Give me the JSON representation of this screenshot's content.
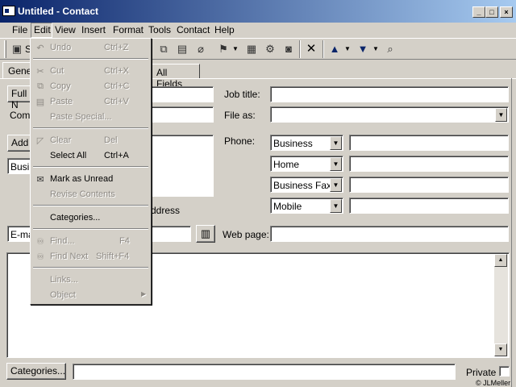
{
  "window": {
    "title": "Untitled - Contact",
    "min_glyph": "_",
    "max_glyph": "□",
    "close_glyph": "×"
  },
  "menubar": {
    "items": [
      "File",
      "Edit",
      "View",
      "Insert",
      "Format",
      "Tools",
      "Contact",
      "Help"
    ]
  },
  "toolbar": {
    "save_label_partial": "S",
    "icons": [
      "save-icon",
      "copy-icon",
      "paste-icon",
      "attach-icon",
      "follow-up-icon",
      "new-item-icon",
      "properties-icon",
      "address-book-icon",
      "delete-icon",
      "previous-item-icon",
      "next-item-icon",
      "find-contact-icon"
    ]
  },
  "tabs": {
    "general_partial": "Gene",
    "all_fields": "All Fields"
  },
  "form": {
    "full_name_partial": "Full N",
    "company_partial": "Comp",
    "job_title_label": "Job title:",
    "file_as_label": "File as:",
    "address_button_partial": "Add",
    "address_type_partial": "Busin",
    "mailing_address_partial": "ddress",
    "phone_label": "Phone:",
    "phones": [
      {
        "type": "Business",
        "value": ""
      },
      {
        "type": "Home",
        "value": ""
      },
      {
        "type": "Business Fax",
        "value": ""
      },
      {
        "type": "Mobile",
        "value": ""
      }
    ],
    "email_partial": "E-mai",
    "web_page_label": "Web page:",
    "categories_button": "Categories...",
    "private_label": "Private",
    "copyright": "© JLMeller"
  },
  "edit_menu": {
    "items": [
      {
        "label": "Undo",
        "shortcut": "Ctrl+Z",
        "disabled": true,
        "icon": "undo-icon"
      },
      {
        "label": "Cut",
        "shortcut": "Ctrl+X",
        "disabled": true,
        "icon": "cut-icon"
      },
      {
        "label": "Copy",
        "shortcut": "Ctrl+C",
        "disabled": true,
        "icon": "copy-icon"
      },
      {
        "label": "Paste",
        "shortcut": "Ctrl+V",
        "disabled": true,
        "icon": "paste-icon"
      },
      {
        "label": "Paste Special...",
        "shortcut": "",
        "disabled": true,
        "icon": ""
      },
      {
        "label": "Clear",
        "shortcut": "Del",
        "disabled": true,
        "icon": "eraser-icon"
      },
      {
        "label": "Select All",
        "shortcut": "Ctrl+A",
        "disabled": false,
        "icon": ""
      },
      {
        "label": "Mark as Unread",
        "shortcut": "",
        "disabled": false,
        "icon": "envelope-icon"
      },
      {
        "label": "Revise Contents",
        "shortcut": "",
        "disabled": true,
        "icon": ""
      },
      {
        "label": "Categories...",
        "shortcut": "",
        "disabled": false,
        "icon": ""
      },
      {
        "label": "Find...",
        "shortcut": "F4",
        "disabled": true,
        "icon": "binoculars-icon"
      },
      {
        "label": "Find Next",
        "shortcut": "Shift+F4",
        "disabled": true,
        "icon": "binoculars-next-icon"
      },
      {
        "label": "Links...",
        "shortcut": "",
        "disabled": true,
        "icon": ""
      },
      {
        "label": "Object",
        "shortcut": "",
        "disabled": true,
        "icon": ""
      }
    ]
  }
}
